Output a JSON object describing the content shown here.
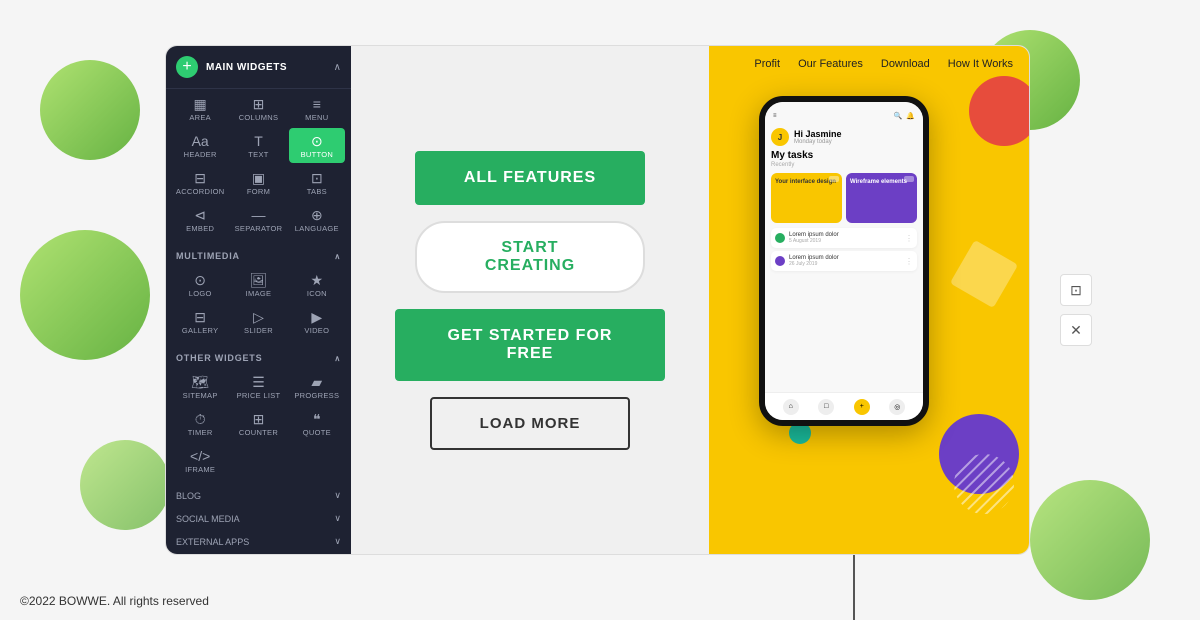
{
  "page": {
    "footer": "©2022 BOWWE. All rights reserved"
  },
  "sidebar": {
    "add_btn": "+",
    "main_section": "MAIN WIDGETS",
    "multimedia_section": "MULTIMEDIA",
    "other_section": "OTHER WIDGETS",
    "blog_section": "BLOG",
    "social_section": "SOCIAL MEDIA",
    "external_section": "EXTERNAL APPS",
    "widgets_main": [
      {
        "icon": "▦",
        "label": "AREA"
      },
      {
        "icon": "⊞",
        "label": "COLUMNS"
      },
      {
        "icon": "≡",
        "label": "MENU"
      },
      {
        "icon": "Aa",
        "label": "HEADER"
      },
      {
        "icon": "T",
        "label": "TEXT"
      },
      {
        "icon": "⊙",
        "label": "BUTTON",
        "active": true
      },
      {
        "icon": "⊟",
        "label": "ACCORDION"
      },
      {
        "icon": "▣",
        "label": "FORM"
      },
      {
        "icon": "⊡",
        "label": "TABS"
      },
      {
        "icon": "⊲",
        "label": "EMBED"
      },
      {
        "icon": "—",
        "label": "SEPARATOR"
      },
      {
        "icon": "⊕",
        "label": "LANGUAGE"
      }
    ],
    "widgets_media": [
      {
        "icon": "⊙",
        "label": "LOGO"
      },
      {
        "icon": "🖼",
        "label": "IMAGE"
      },
      {
        "icon": "★",
        "label": "ICON"
      },
      {
        "icon": "⊟",
        "label": "GALLERY"
      },
      {
        "icon": "▷",
        "label": "SLIDER"
      },
      {
        "icon": "▶",
        "label": "VIDEO"
      }
    ],
    "widgets_other": [
      {
        "icon": "🗺",
        "label": "SITEMAP"
      },
      {
        "icon": "☰",
        "label": "PRICE LIST"
      },
      {
        "icon": "▰",
        "label": "PROGRESS"
      },
      {
        "icon": "⏱",
        "label": "TIMER"
      },
      {
        "icon": "⊞",
        "label": "COUNTER"
      },
      {
        "icon": "❝",
        "label": "QUOTE"
      },
      {
        "icon": "</>",
        "label": "IFRAME"
      }
    ]
  },
  "canvas": {
    "btn_all_features": "ALL FEATURES",
    "btn_start_creating": "START CREATING",
    "btn_get_started": "GET STARTED FOR FREE",
    "btn_load_more": "LOAD MORE"
  },
  "preview": {
    "nav_items": [
      "Profit",
      "Our Features",
      "Download",
      "How It Works"
    ],
    "phone": {
      "greeting": "Hi Jasmine",
      "sub_text": "Monday today",
      "my_tasks": "My tasks",
      "recently": "Recently",
      "card1_label": "Your interface design",
      "card2_label": "Wireframe elements",
      "list_item1": "Lorem ipsum dolor",
      "list_item1_date": "5 August 2019",
      "list_item2": "Lorem ipsum dolor",
      "list_item2_date": "26 July 2019"
    }
  },
  "toolbar": {
    "copy_icon": "⊡",
    "close_icon": "✕"
  },
  "colors": {
    "green_accent": "#27ae60",
    "yellow": "#f9c600",
    "purple": "#6c3fc5",
    "coral": "#e74c3c",
    "dark_sidebar": "#1e2232"
  }
}
